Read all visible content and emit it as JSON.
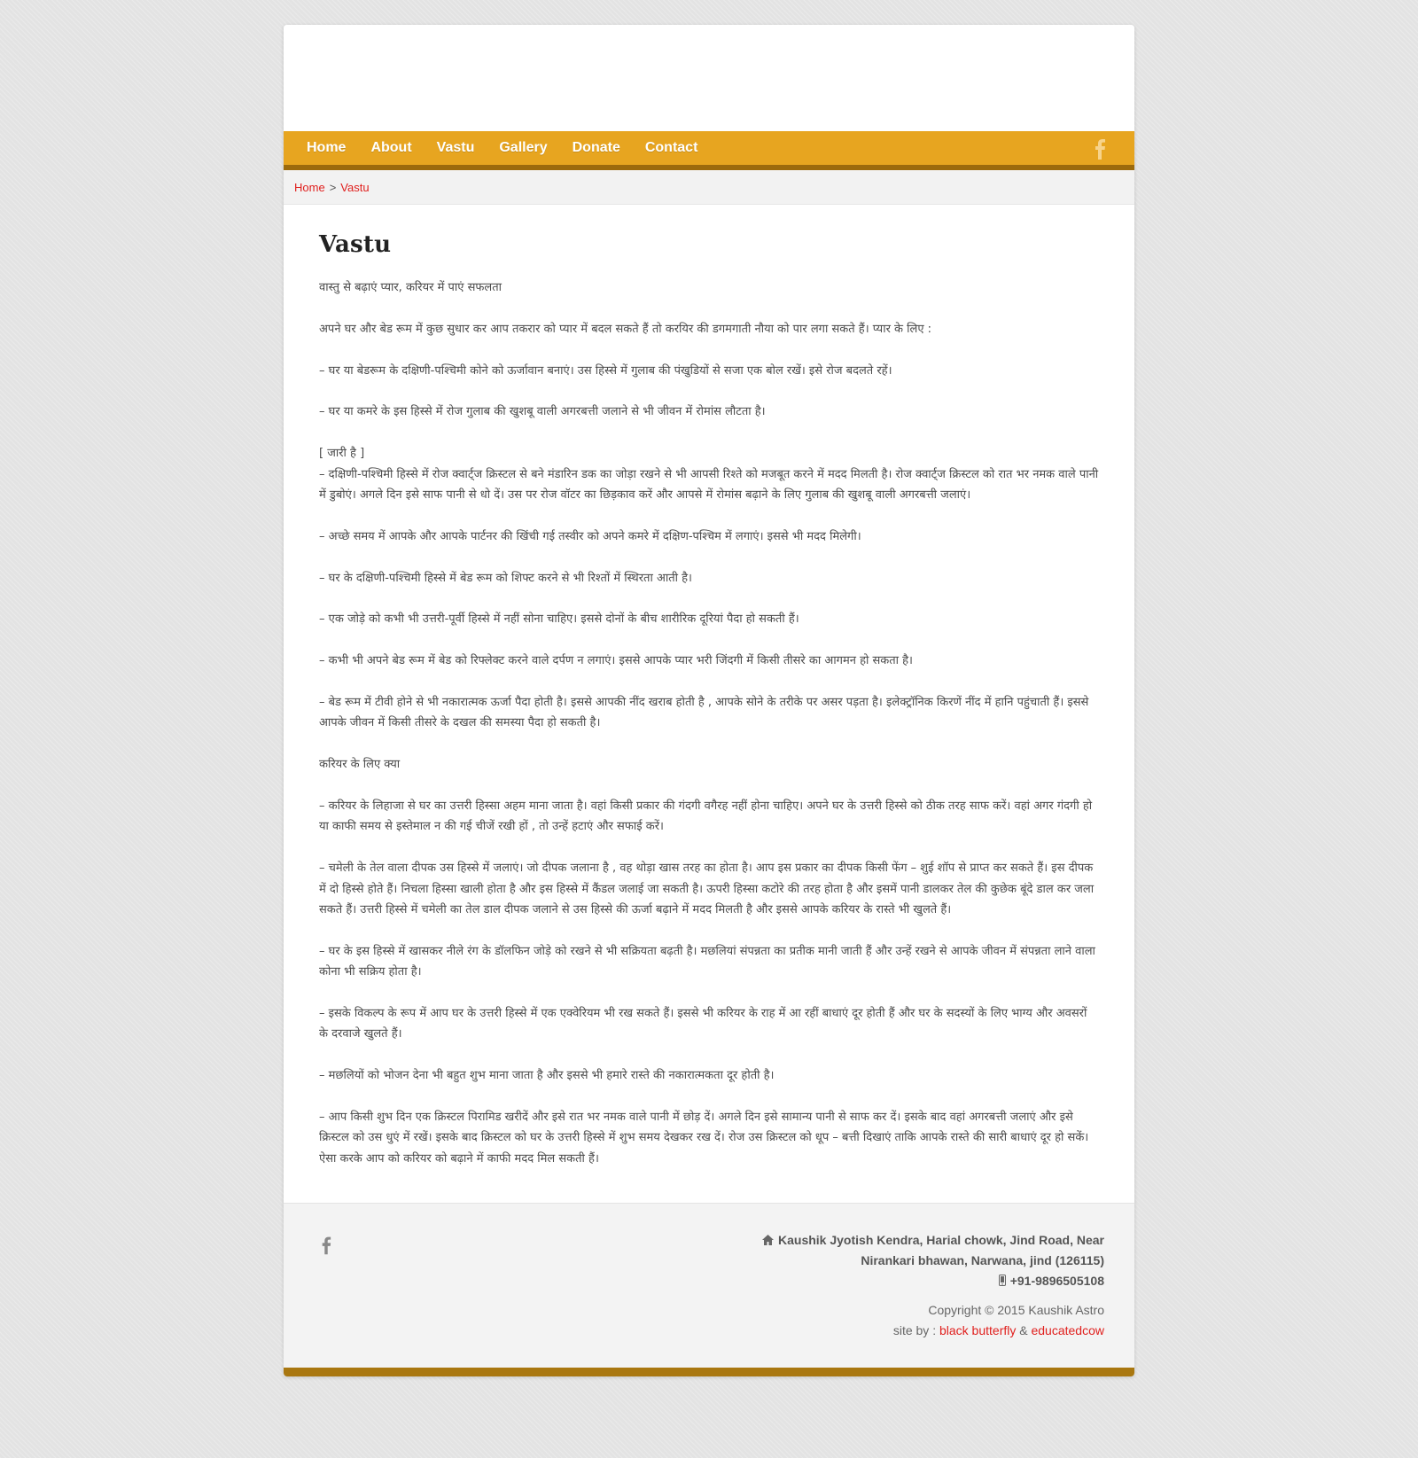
{
  "nav": {
    "items": [
      {
        "label": "Home"
      },
      {
        "label": "About"
      },
      {
        "label": "Vastu"
      },
      {
        "label": "Gallery"
      },
      {
        "label": "Donate"
      },
      {
        "label": "Contact"
      }
    ],
    "social_icon": "facebook-icon"
  },
  "breadcrumb": {
    "home": "Home",
    "separator": ">",
    "current": "Vastu"
  },
  "main": {
    "title": "Vastu",
    "paragraphs": [
      "वास्तु से बढ़ाएं प्यार, करियर में पाएं सफलता",
      "अपने घर और बेड रूम में कुछ सुधार कर आप तकरार को प्यार में बदल सकते हैं तो करयिर की डगमगाती नौया को पार लगा सकते हैं। प्यार के लिए :",
      "– घर या बेडरूम के दक्षिणी-पश्चिमी कोने को ऊर्जावान बनाएं। उस हिस्से में गुलाब की पंखुडियों से सजा एक बोल रखें। इसे रोज बदलते रहें।",
      "– घर या कमरे के इस हिस्से में रोज गुलाब की खुशबू वाली अगरबत्ती जलाने से भी जीवन में रोमांस लौटता है।",
      "[ जारी है ]\n– दक्षिणी-पश्चिमी हिस्से में रोज क्वार्ट्ज क्रिस्टल से बने मंडारिन डक का जोड़ा रखने से भी आपसी रिश्ते को मजबूत करने में मदद मिलती है। रोज क्वार्ट्ज क्रिस्टल को रात भर नमक वाले पानी में डुबोएं। अगले दिन इसे साफ पानी से धो दें। उस पर रोज वॉटर का छिड़काव करें और आपसे में रोमांस बढ़ाने के लिए गुलाब की खुशबू वाली अगरबत्ती जलाएं।",
      "– अच्छे समय में आपके और आपके पार्टनर की खिंची गई तस्वीर को अपने कमरे में दक्षिण-पश्चिम में लगाएं। इससे भी मदद मिलेगी।",
      "– घर के दक्षिणी-पश्चिमी हिस्से में बेड रूम को शिफ्ट करने से भी रिश्तों में स्थिरता आती है।",
      "– एक जोड़े को कभी भी उत्तरी-पूर्वी हिस्से में नहीं सोना चाहिए। इससे दोनों के बीच शारीरिक दूरियां पैदा हो सकती हैं।",
      "– कभी भी अपने बेड रूम में बेड को रिफ्लेक्ट करने वाले दर्पण न लगाएं। इससे आपके प्यार भरी जिंदगी में किसी तीसरे का आगमन हो सकता है।",
      "– बेड रूम में टीवी होने से भी नकारात्मक ऊर्जा पैदा होती है। इससे आपकी नींद खराब होती है , आपके सोने के तरीके पर असर पड़ता है। इलेक्ट्रॉनिक किरणें नींद में हानि पहुंचाती हैं। इससे आपके जीवन में किसी तीसरे के दखल की समस्या पैदा हो सकती है।",
      "करियर के लिए क्या",
      "– करियर के लिहाजा से घर का उत्तरी हिस्सा अहम माना जाता है। वहां किसी प्रकार की गंदगी वगैरह नहीं होना चाहिए। अपने घर के उत्तरी हिस्से को ठीक तरह साफ करें। वहां अगर गंदगी हो या काफी समय से इस्तेमाल न की गई चीजें रखी हों , तो उन्हें हटाएं और सफाई करें।",
      "– चमेली के तेल वाला दीपक उस हिस्से में जलाएं। जो दीपक जलाना है , वह थोड़ा खास तरह का होता है। आप इस प्रकार का दीपक किसी फेंग – शुई शॉप से प्राप्त कर सकते हैं। इस दीपक में दो हिस्से होते हैं। निचला हिस्सा खाली होता है और इस हिस्से में कैंडल जलाई जा सकती है। ऊपरी हिस्सा कटोरे की तरह होता है और इसमें पानी डालकर तेल की कुछेक बूंदे डाल कर जला सकते हैं। उत्तरी हिस्से में चमेली का तेल डाल दीपक जलाने से उस हिस्से की ऊर्जा बढ़ाने में मदद मिलती है और इससे आपके करियर के रास्ते भी खुलते हैं।",
      "– घर के इस हिस्से में खासकर नीले रंग के डॉलफिन जोड़े को रखने से भी सक्रियता बढ़ती है। मछलियां संपन्नता का प्रतीक मानी जाती हैं और उन्हें रखने से आपके जीवन में संपन्नता लाने वाला कोना भी सक्रिय होता है।",
      "– इसके विकल्प के रूप में आप घर के उत्तरी हिस्से में एक एक्वेरियम भी रख सकते हैं। इससे भी करियर के राह में आ रहीं बाधाएं दूर होती हैं और घर के सदस्यों के लिए भाग्य और अवसरों के दरवाजे खुलते हैं।",
      "– मछलियों को भोजन देना भी बहुत शुभ माना जाता है और इससे भी हमारे रास्ते की नकारात्मकता दूर होती है।",
      "– आप किसी शुभ दिन एक क्रिस्टल पिरामिड खरीदें और इसे रात भर नमक वाले पानी में छोड़ दें। अगले दिन इसे सामान्य पानी से साफ कर दें। इसके बाद वहां अगरबत्ती जलाएं और इसे क्रिस्टल को उस धुएं में रखें। इसके बाद क्रिस्टल को घर के उत्तरी हिस्से में शुभ समय देखकर रख दें। रोज उस क्रिस्टल को धूप – बत्ती दिखाएं ताकि आपके रास्ते की सारी बाधाएं दूर हो सकें। ऐसा करके आप को करियर को बढ़ाने में काफी मदद मिल सकती हैं।"
    ]
  },
  "footer": {
    "social_icon": "facebook-icon",
    "address_line1": "Kaushik Jyotish Kendra, Harial chowk, Jind Road, Near",
    "address_line2": "Nirankari bhawan, Narwana, jind (126115)",
    "phone": "+91-9896505108",
    "copyright": "Copyright © 2015 Kaushik Astro",
    "site_by_label": "site by :",
    "credit1": "black butterfly",
    "credit_sep": "&",
    "credit2": "educatedcow"
  },
  "colors": {
    "nav_bg": "#e7a520",
    "nav_border": "#9c6a0c",
    "link": "#e0201e",
    "footer_bar": "#a97710"
  }
}
